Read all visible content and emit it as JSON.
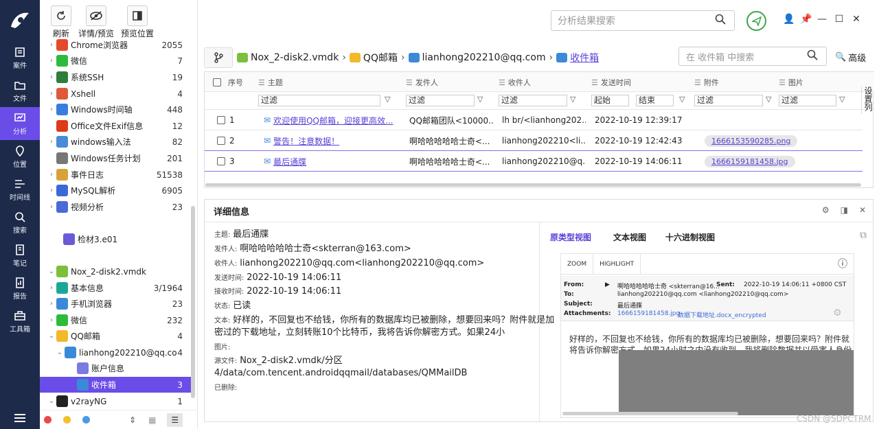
{
  "rail": {
    "items": [
      {
        "label": "案件",
        "icon": "case-icon"
      },
      {
        "label": "文件",
        "icon": "folder-icon"
      },
      {
        "label": "分析",
        "icon": "analysis-icon",
        "active": true
      },
      {
        "label": "位置",
        "icon": "location-pin-icon"
      },
      {
        "label": "时间线",
        "icon": "timeline-icon"
      },
      {
        "label": "搜索",
        "icon": "search-icon"
      },
      {
        "label": "笔记",
        "icon": "note-icon"
      },
      {
        "label": "报告",
        "icon": "report-icon"
      },
      {
        "label": "工具箱",
        "icon": "toolbox-icon"
      }
    ],
    "accent": "#6a4de8",
    "bg": "#1e2a4a"
  },
  "toolbar": {
    "refresh": "刷新",
    "details": "详情/预览",
    "preview_pos": "预览位置"
  },
  "tree": {
    "rows": [
      {
        "label": "Chrome浏览器",
        "count": "2055",
        "icon": "chrome-icon",
        "color": "#e44a2a"
      },
      {
        "label": "微信",
        "count": "7",
        "icon": "wechat-icon",
        "color": "#2dbb3b"
      },
      {
        "label": "系统SSH",
        "count": "19",
        "icon": "ssh-icon",
        "color": "#2f7d3a"
      },
      {
        "label": "Xshell",
        "count": "4",
        "icon": "xshell-icon",
        "color": "#e05a3a"
      },
      {
        "label": "Windows时间轴",
        "count": "448",
        "icon": "windows-timeline-icon",
        "color": "#3a7de0"
      },
      {
        "label": "Office文件Exif信息",
        "count": "12",
        "icon": "office-icon",
        "color": "#e03a1a"
      },
      {
        "label": "windows输入法",
        "count": "82",
        "icon": "keyboard-icon",
        "color": "#4a8ad8"
      },
      {
        "label": "Windows任务计划",
        "count": "201",
        "icon": "clock-icon",
        "color": "#777777"
      },
      {
        "label": "事件日志",
        "count": "51538",
        "icon": "event-log-icon",
        "color": "#d8a23a"
      },
      {
        "label": "MySQL解析",
        "count": "6905",
        "icon": "mysql-icon",
        "color": "#3a6ad8"
      },
      {
        "label": "视频分析",
        "count": "23",
        "icon": "video-analysis-icon",
        "color": "#4a6ad8"
      },
      {
        "label": "检材3.e01",
        "count": "",
        "icon": "evidence-file-icon",
        "color": "#6a5ad8"
      },
      {
        "label": "Nox_2-disk2.vmdk",
        "count": "",
        "icon": "android-icon",
        "color": "#7bbf3a"
      },
      {
        "label": "基本信息",
        "count": "3/1964",
        "icon": "basic-info-icon",
        "color": "#1aa896"
      },
      {
        "label": "手机浏览器",
        "count": "23",
        "icon": "mobile-browser-icon",
        "color": "#3a8ad8"
      },
      {
        "label": "微信",
        "count": "232",
        "icon": "wechat-icon",
        "color": "#2dbb3b"
      },
      {
        "label": "QQ邮箱",
        "count": "4",
        "icon": "qqmail-icon",
        "color": "#f2b92a"
      },
      {
        "label": "lianhong202210@qq.co...",
        "count": "4",
        "icon": "mail-icon",
        "color": "#3a8ad8"
      },
      {
        "label": "账户信息",
        "count": "",
        "icon": "account-icon",
        "color": "#7a7ae0"
      },
      {
        "label": "收件箱",
        "count": "3",
        "icon": "inbox-icon",
        "color": "#3a8ad8",
        "selected": true
      },
      {
        "label": "v2rayNG",
        "count": "1",
        "icon": "v2ray-icon",
        "color": "#222222"
      }
    ]
  },
  "top": {
    "search_placeholder": "分析结果搜索"
  },
  "breadcrumb": [
    {
      "label": "Nox_2-disk2.vmdk",
      "icon": "android-icon"
    },
    {
      "label": "QQ邮箱",
      "icon": "qqmail-icon"
    },
    {
      "label": "lianhong202210@qq.com",
      "icon": "mail-icon"
    },
    {
      "label": "收件箱",
      "icon": "inbox-icon",
      "link": true
    }
  ],
  "inner_search": {
    "placeholder": "在 收件箱 中搜索",
    "advanced": "高级"
  },
  "table": {
    "headers": [
      "序号",
      "主题",
      "发件人",
      "收件人",
      "发送时间",
      "附件",
      "图片"
    ],
    "filter": "过滤",
    "start": "起始",
    "end": "结束",
    "set_columns": "设置列",
    "rows": [
      {
        "no": "1",
        "subject": "欢迎使用QQ邮箱，迎接更高效...",
        "from": "QQ邮箱团队<10000...",
        "to": "lh br/<lianhong202...",
        "time": "2022-10-19 12:39:17",
        "attach": ""
      },
      {
        "no": "2",
        "subject": "警告！注意数据！",
        "from": "啊哈哈哈哈哈士奇<...",
        "to": "lianhong202210<li...",
        "time": "2022-10-19 12:42:43",
        "attach": "1666153590285.png"
      },
      {
        "no": "3",
        "subject": "最后通牒",
        "from": "啊哈哈哈哈哈士奇<...",
        "to": "lianhong202210@q...",
        "time": "2022-10-19 14:06:11",
        "attach": "1666159181458.jpg"
      }
    ]
  },
  "detail": {
    "title": "详细信息",
    "fields": [
      {
        "k": "主题:",
        "v": "最后通牒"
      },
      {
        "k": "发件人:",
        "v": "啊哈哈哈哈哈士奇<skterran@163.com>"
      },
      {
        "k": "收件人:",
        "v": "lianhong202210@qq.com<lianhong202210@qq.com>"
      },
      {
        "k": "发送时间:",
        "v": "2022-10-19 14:06:11"
      },
      {
        "k": "接收时间:",
        "v": "2022-10-19 14:06:11"
      },
      {
        "k": "状态:",
        "v": "已读"
      },
      {
        "k": "文本:",
        "v": "好样的，不回复也不给钱，你所有的数据库均已被删除，想要回来吗？附件就是加"
      },
      {
        "k": "",
        "v": "密过的下载地址，立刻转账10个比特币，我将告诉你解密方式。如果24小"
      },
      {
        "k": "图片:",
        "v": ""
      },
      {
        "k": "源文件:",
        "v": "Nox_2-disk2.vmdk/分区"
      },
      {
        "k": "",
        "v": "4/data/com.tencent.androidqqmail/databases/QMMailDB"
      },
      {
        "k": "已删除:",
        "v": ""
      }
    ],
    "tabs": [
      "原类型视图",
      "文本视图",
      "十六进制视图"
    ],
    "preview": {
      "zoom": "ZOOM",
      "highlight": "HIGHLIGHT",
      "from_k": "From:",
      "from_v": "啊哈哈哈哈哈士奇 <skterran@16...",
      "sent_k": "Sent:",
      "sent_v": "2022-10-19 14:06:11 +0800 CST",
      "to_k": "To:",
      "to_v": "lianhong202210@qq.com <lianhong202210@qq.com>",
      "subj_k": "Subject:",
      "subj_v": "最后通牒",
      "att_k": "Attachments:",
      "att_v1": "1666159181458.jpg",
      "att_v2": "数据下载地址.docx_encrypted",
      "body1": "好样的，不回复也不给钱，你所有的数据库均已被删除，想要回来吗？附件就",
      "body2": "将告诉你解密方式，如果24小时之内没有收到，我将删除数据并以受害人身份"
    }
  },
  "watermark": "CSDN @SDPCTRM"
}
